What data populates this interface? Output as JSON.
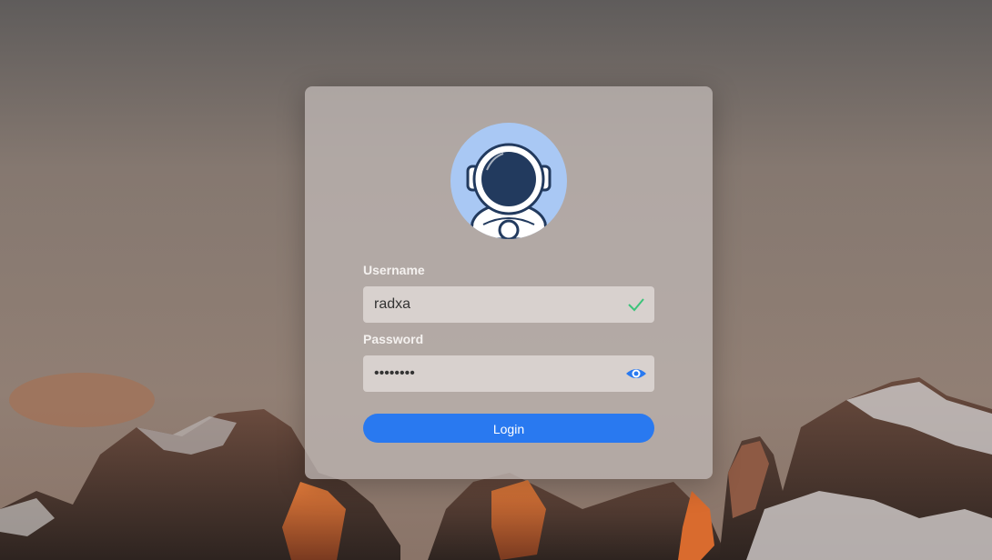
{
  "login": {
    "username_label": "Username",
    "username_value": "radxa",
    "password_label": "Password",
    "password_value": "••••••••",
    "login_button": "Login"
  },
  "icons": {
    "valid": "checkmark-icon",
    "reveal": "eye-icon",
    "avatar": "astronaut-avatar"
  },
  "colors": {
    "accent": "#2979f0",
    "valid": "#3cc37a",
    "avatar_bg": "#a9c8f4"
  }
}
